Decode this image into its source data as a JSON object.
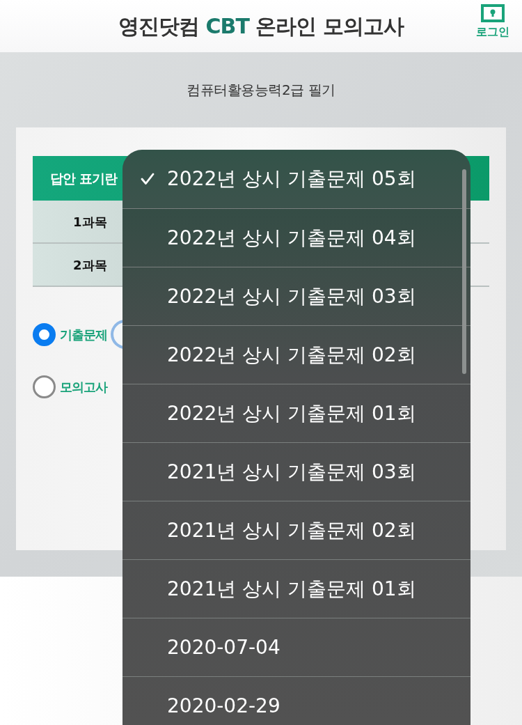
{
  "header": {
    "title_parts": [
      {
        "text": "영진닷컴 ",
        "highlight": false
      },
      {
        "text": "CBT",
        "highlight": true
      },
      {
        "text": " 온라인 모의고사",
        "highlight": false
      }
    ],
    "login": {
      "label": "로그인"
    }
  },
  "subtitle": "컴퓨터활용능력2급 필기",
  "answer_table": {
    "header": "답안 표기란",
    "rows": [
      {
        "label": "1과목"
      },
      {
        "label": "2과목"
      }
    ]
  },
  "exam_types": [
    {
      "label": "기출문제",
      "selected": true
    },
    {
      "label": "모의고사",
      "selected": false
    }
  ],
  "dropdown": {
    "options": [
      {
        "label": "2022년 상시 기출문제 05회",
        "selected": true
      },
      {
        "label": "2022년 상시 기출문제 04회",
        "selected": false
      },
      {
        "label": "2022년 상시 기출문제 03회",
        "selected": false
      },
      {
        "label": "2022년 상시 기출문제 02회",
        "selected": false
      },
      {
        "label": "2022년 상시 기출문제 01회",
        "selected": false
      },
      {
        "label": "2021년 상시 기출문제 03회",
        "selected": false
      },
      {
        "label": "2021년 상시 기출문제 02회",
        "selected": false
      },
      {
        "label": "2021년 상시 기출문제 01회",
        "selected": false
      },
      {
        "label": "2020-07-04",
        "selected": false
      },
      {
        "label": "2020-02-29",
        "selected": false
      }
    ]
  }
}
